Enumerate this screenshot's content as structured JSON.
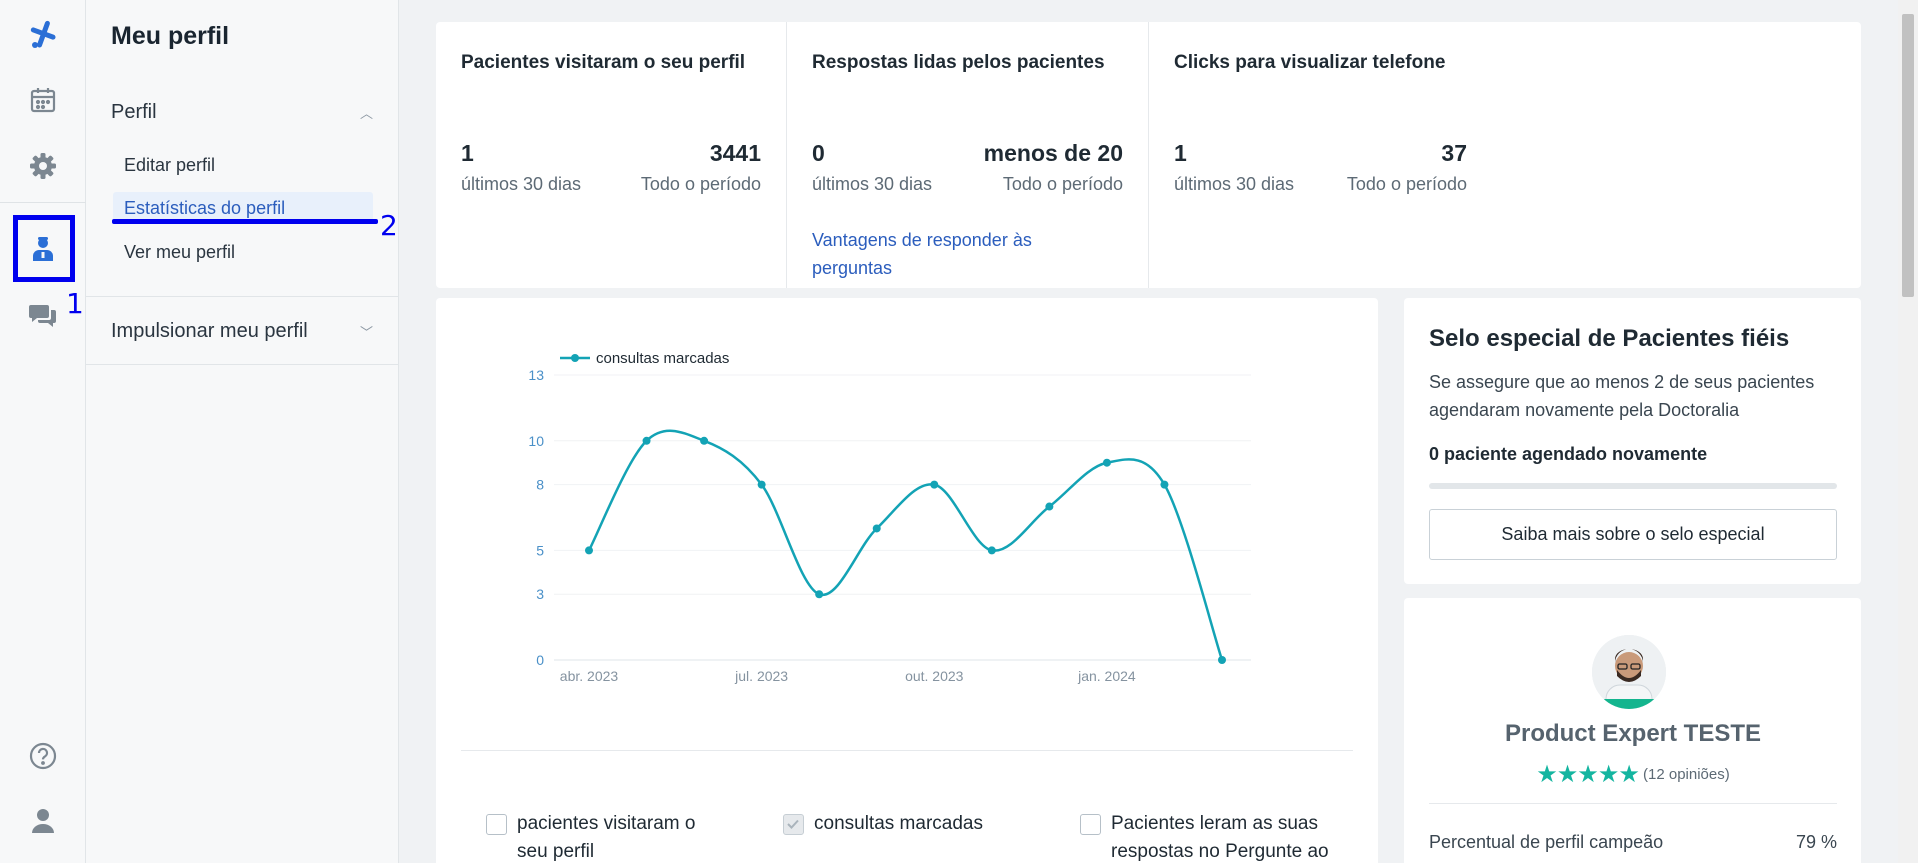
{
  "rail": {
    "logo_icon": "doctoralia-logo-icon",
    "items": [
      "calendar-icon",
      "gear-icon",
      "doctor-profile-icon",
      "chat-icon",
      "help-icon",
      "user-icon"
    ]
  },
  "annotations": {
    "label_1": "1",
    "label_2": "2"
  },
  "submenu": {
    "title": "Meu perfil",
    "section_profile": "Perfil",
    "items": [
      "Editar perfil",
      "Estatísticas do perfil",
      "Ver meu perfil"
    ],
    "section_boost": "Impulsionar meu perfil"
  },
  "stats": [
    {
      "title": "Pacientes visitaram o seu perfil",
      "recent_value": "1",
      "recent_label": "últimos 30 dias",
      "total_value": "3441",
      "total_label": "Todo o período"
    },
    {
      "title": "Respostas lidas pelos pacientes",
      "recent_value": "0",
      "recent_label": "últimos 30 dias",
      "total_value": "menos de 20",
      "total_label": "Todo o período",
      "link": "Vantagens de responder às perguntas"
    },
    {
      "title": "Clicks para visualizar telefone",
      "recent_value": "1",
      "recent_label": "últimos 30 dias",
      "total_value": "37",
      "total_label": "Todo o período"
    }
  ],
  "chart_data": {
    "type": "line",
    "series": [
      {
        "name": "consultas marcadas",
        "color": "#13a3b5",
        "x": [
          "2023-04",
          "2023-05",
          "2023-06",
          "2023-07",
          "2023-08",
          "2023-09",
          "2023-10",
          "2023-11",
          "2023-12",
          "2024-01",
          "2024-02",
          "2024-03"
        ],
        "values": [
          5,
          10,
          10,
          8,
          3,
          6,
          8,
          5,
          7,
          9,
          8,
          0
        ]
      }
    ],
    "x_tick_labels": [
      "abr. 2023",
      "jul. 2023",
      "out. 2023",
      "jan. 2024"
    ],
    "y_ticks": [
      0,
      3,
      5,
      8,
      10,
      13
    ],
    "ylim": [
      0,
      12.5
    ],
    "grid": true,
    "legend_position": "top-left"
  },
  "checkboxes": [
    {
      "label": "pacientes visitaram o seu perfil",
      "checked": false
    },
    {
      "label": "consultas marcadas",
      "checked": true
    },
    {
      "label": "Pacientes leram as suas respostas no Pergunte ao",
      "checked": false
    }
  ],
  "selo": {
    "title": "Selo especial de Pacientes fiéis",
    "text": "Se assegure que ao menos 2 de seus pacientes agendaram novamente pela Doctoralia",
    "count": "0 paciente agendado novamente",
    "progress": 0,
    "button": "Saiba mais sobre o selo especial"
  },
  "profile": {
    "name": "Product Expert TESTE",
    "rating": 5,
    "stars": "★★★★★",
    "reviews": "(12 opiniões)",
    "completeness_label": "Percentual de perfil campeão",
    "completeness_value": "79 %"
  }
}
